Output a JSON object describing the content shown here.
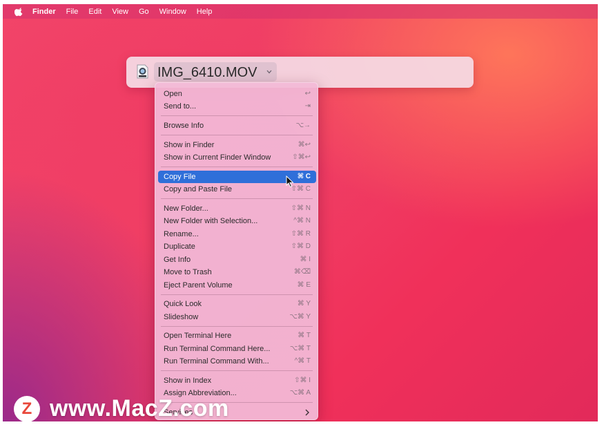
{
  "menubar": {
    "items": [
      {
        "label": "Finder",
        "bold": true
      },
      {
        "label": "File"
      },
      {
        "label": "Edit"
      },
      {
        "label": "View"
      },
      {
        "label": "Go"
      },
      {
        "label": "Window"
      },
      {
        "label": "Help"
      }
    ]
  },
  "title_panel": {
    "file_name": "IMG_6410.MOV",
    "file_icon": "quicktime-movie-icon"
  },
  "context_menu": {
    "items": [
      {
        "label": "Open",
        "shortcut": "↩"
      },
      {
        "label": "Send to...",
        "shortcut": "⇥"
      },
      {
        "label": "Browse Info",
        "shortcut": "⌥→"
      },
      {
        "label": "Show in Finder",
        "shortcut": "⌘↩"
      },
      {
        "label": "Show in Current Finder Window",
        "shortcut": "⇧⌘↩"
      },
      {
        "label": "Copy File",
        "shortcut": "⌘ C",
        "highlighted": true
      },
      {
        "label": "Copy and Paste File",
        "shortcut": "⇧⌘ C"
      },
      {
        "label": "New Folder...",
        "shortcut": "⇧⌘ N"
      },
      {
        "label": "New Folder with Selection...",
        "shortcut": "^⌘ N"
      },
      {
        "label": "Rename...",
        "shortcut": "⇧⌘ R"
      },
      {
        "label": "Duplicate",
        "shortcut": "⇧⌘ D"
      },
      {
        "label": "Get Info",
        "shortcut": "⌘ I"
      },
      {
        "label": "Move to Trash",
        "shortcut": "⌘⌫"
      },
      {
        "label": "Eject Parent Volume",
        "shortcut": "⌘ E"
      },
      {
        "label": "Quick Look",
        "shortcut": "⌘ Y"
      },
      {
        "label": "Slideshow",
        "shortcut": "⌥⌘ Y"
      },
      {
        "label": "Open Terminal Here",
        "shortcut": "⌘ T"
      },
      {
        "label": "Run Terminal Command Here...",
        "shortcut": "⌥⌘ T"
      },
      {
        "label": "Run Terminal Command With...",
        "shortcut": "^⌘ T"
      },
      {
        "label": "Show in Index",
        "shortcut": "⇧⌘ I"
      },
      {
        "label": "Assign Abbreviation...",
        "shortcut": "⌥⌘ A"
      },
      {
        "label": "Services",
        "submenu": true
      }
    ]
  },
  "watermark": {
    "logo_letter": "Z",
    "text": "www.MacZ.com"
  },
  "colors": {
    "highlight": "#2f6fd9",
    "menu_bg": "#f2b9d7",
    "wallpaper": "#ef3d63"
  }
}
